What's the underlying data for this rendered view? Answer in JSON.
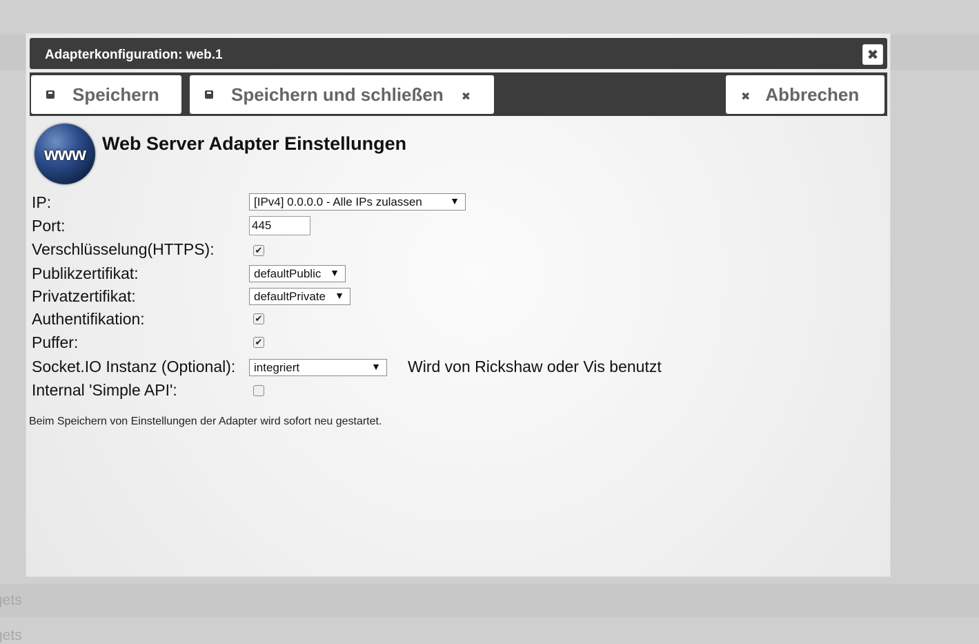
{
  "background": {
    "items": [
      "gets",
      "gets"
    ]
  },
  "dialog": {
    "title": "Adapterkonfiguration: web.1",
    "close_icon": "✖"
  },
  "toolbar": {
    "save_label": "Speichern",
    "save_close_label": "Speichern und schließen",
    "cancel_label": "Abbrechen",
    "close_glyph": "✖"
  },
  "header": {
    "logo_text": "www",
    "title": "Web Server Adapter Einstellungen"
  },
  "form": {
    "ip": {
      "label": "IP:",
      "value": "[IPv4] 0.0.0.0 - Alle IPs zulassen"
    },
    "port": {
      "label": "Port:",
      "value": "445"
    },
    "https": {
      "label": "Verschlüsselung(HTTPS):",
      "checked": true
    },
    "public_cert": {
      "label": "Publikzertifikat:",
      "value": "defaultPublic"
    },
    "private_cert": {
      "label": "Privatzertifikat:",
      "value": "defaultPrivate"
    },
    "auth": {
      "label": "Authentifikation:",
      "checked": true
    },
    "buffer": {
      "label": "Puffer:",
      "checked": true
    },
    "socketio": {
      "label": "Socket.IO Instanz (Optional):",
      "value": "integriert",
      "hint": "Wird von Rickshaw oder Vis benutzt"
    },
    "simple_api": {
      "label": "Internal 'Simple API':",
      "checked": false
    }
  },
  "note": "Beim Speichern von Einstellungen der Adapter wird sofort neu gestartet.",
  "glyphs": {
    "caret": "▼",
    "check": "✔"
  }
}
